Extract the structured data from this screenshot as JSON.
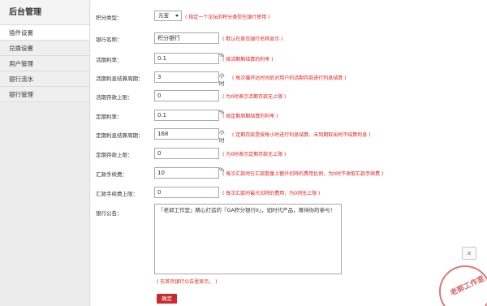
{
  "sidebar": {
    "title": "后台管理",
    "items": [
      {
        "label": "插件设置"
      },
      {
        "label": "兑换设置"
      },
      {
        "label": "用户管理"
      },
      {
        "label": "银行流水"
      },
      {
        "label": "银行管理"
      }
    ]
  },
  "form": {
    "credit_type": {
      "label": "积分类型：",
      "value": "元宝",
      "hint": "( 指定一个论坛的积分类型在银行使用 )"
    },
    "bank_name": {
      "label": "银行名称：",
      "value": "积分银行",
      "hint": "( 默认在首页银行名称显示 )"
    },
    "demand_rate": {
      "label": "活期利率：",
      "value": "0.1",
      "unit": "%",
      "hint": "( 按活期期结算的利率 )"
    },
    "demand_period": {
      "label": "活期利息结算周期：",
      "value": "3",
      "unit": "小时",
      "hint": "( 每次循环达时间后对用户的活期存款进行利息结算 )"
    },
    "demand_limit": {
      "label": "活期存款上限：",
      "value": "0",
      "hint": "( 为0时表示活期存款无上限 )"
    },
    "fixed_rate": {
      "label": "定期利率：",
      "value": "0.1",
      "unit": "%",
      "hint": "( 按定期周期结算的利率 )"
    },
    "fixed_period": {
      "label": "定期利息结算周期：",
      "value": "168",
      "unit": "小时",
      "hint": "( 定期存款是按每小时进行利息结算，未到期取出时不结算利息 )"
    },
    "fixed_limit": {
      "label": "定期存款上限：",
      "value": "0",
      "hint": "( 为0时表示定期存款无上限 )"
    },
    "remit_fee": {
      "label": "汇款手续费：",
      "value": "10",
      "unit": "%",
      "hint": "( 每次汇款时在汇款数量上额外扣除的费用比例，为0时不收取汇款手续费 )"
    },
    "remit_fee_limit": {
      "label": "汇款手续费上限：",
      "value": "0",
      "hint": "( 每次汇款时最大扣除的费用，为0则无上限 )"
    },
    "notice": {
      "label": "银行公告：",
      "value": "『老郭工作室』精心打造的『GA积分银行II』，如时代产品，尊待你的参与！",
      "hint": "( 在首页银行公告里显示。 )"
    },
    "submit_label": "确定"
  },
  "scroll_top_icon": "scroll-top-icon",
  "stamp_text": "老郭工作室",
  "colors": {
    "hint": "#e02020",
    "submit": "#c82b2b",
    "sidebar_bg": "#ececec"
  }
}
